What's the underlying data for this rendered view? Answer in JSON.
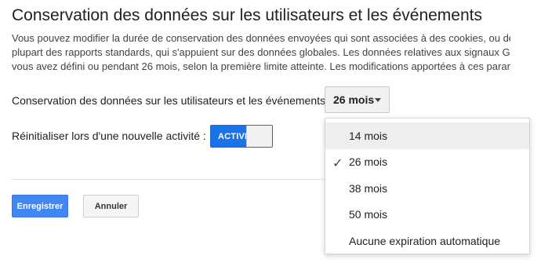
{
  "title": "Conservation des données sur les utilisateurs et les événements",
  "description": [
    "Vous pouvez modifier la durée de conservation des données envoyées qui sont associées à des cookies, ou des",
    "plupart des rapports standards, qui s'appuient sur des données globales. Les données relatives aux signaux Goo",
    "vous avez défini ou pendant 26 mois, selon la première limite atteinte. Les modifications apportées à ces param"
  ],
  "retention": {
    "label": "Conservation des données sur les utilisateurs et les événements :",
    "help_icon": "help-circle-icon",
    "help_glyph": "?",
    "selected": "26 mois",
    "options": [
      "14 mois",
      "26 mois",
      "38 mois",
      "50 mois",
      "Aucune expiration automatique"
    ],
    "checked_index": 1,
    "check_glyph": "✓"
  },
  "reset": {
    "label": "Réinitialiser lors d'une nouvelle activité :",
    "help_icon": "help-circle-icon",
    "help_glyph": "?",
    "toggle_label": "ACTIVÉ",
    "toggle_on": true
  },
  "actions": {
    "save_label": "Enregistrer",
    "cancel_label": "Annuler"
  },
  "colors": {
    "primary": "#4285f4",
    "toggle_on": "#1a73e8"
  }
}
